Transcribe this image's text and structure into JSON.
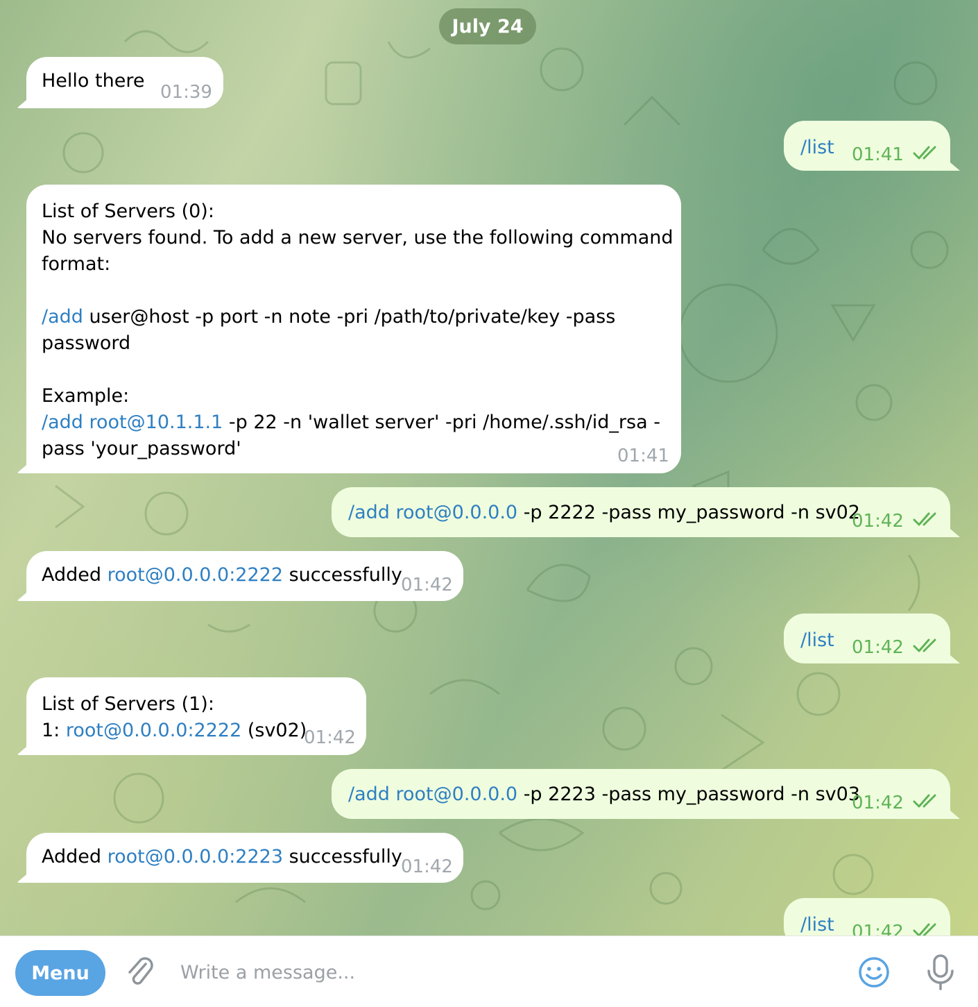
{
  "date_label": "July 24",
  "messages": [
    {
      "dir": "in",
      "time": "01:39",
      "lines": [
        [
          {
            "t": "Hello there"
          }
        ]
      ]
    },
    {
      "dir": "out",
      "time": "01:41",
      "lines": [
        [
          {
            "t": "/list",
            "link": true
          }
        ]
      ]
    },
    {
      "dir": "in",
      "time": "01:41",
      "lines": [
        [
          {
            "t": "List of Servers (0):"
          }
        ],
        [
          {
            "t": "No servers found. To add a new server, use the following command"
          }
        ],
        [
          {
            "t": "format:"
          }
        ],
        [
          {
            "t": ""
          }
        ],
        [
          {
            "t": "/add",
            "link": true
          },
          {
            "t": " user@host -p port -n note -pri /path/to/private/key -pass"
          }
        ],
        [
          {
            "t": "password"
          }
        ],
        [
          {
            "t": ""
          }
        ],
        [
          {
            "t": "Example:"
          }
        ],
        [
          {
            "t": "/add",
            "link": true
          },
          {
            "t": " "
          },
          {
            "t": "root@10.1.1.1",
            "link": true
          },
          {
            "t": " -p 22 -n 'wallet server' -pri /home/.ssh/id_rsa -"
          }
        ],
        [
          {
            "t": "pass 'your_password'"
          }
        ]
      ]
    },
    {
      "dir": "out",
      "time": "01:42",
      "lines": [
        [
          {
            "t": "/add",
            "link": true
          },
          {
            "t": " "
          },
          {
            "t": "root@0.0.0.0",
            "link": true
          },
          {
            "t": " -p 2222 -pass my_password -n sv02"
          }
        ]
      ]
    },
    {
      "dir": "in",
      "time": "01:42",
      "lines": [
        [
          {
            "t": "Added "
          },
          {
            "t": "root@0.0.0.0:2222",
            "link": true
          },
          {
            "t": " successfully"
          }
        ]
      ]
    },
    {
      "dir": "out",
      "time": "01:42",
      "lines": [
        [
          {
            "t": "/list",
            "link": true
          }
        ]
      ]
    },
    {
      "dir": "in",
      "time": "01:42",
      "lines": [
        [
          {
            "t": "List of Servers (1):"
          }
        ],
        [
          {
            "t": "1: "
          },
          {
            "t": "root@0.0.0.0:2222",
            "link": true
          },
          {
            "t": " (sv02)"
          }
        ]
      ]
    },
    {
      "dir": "out",
      "time": "01:42",
      "lines": [
        [
          {
            "t": "/add",
            "link": true
          },
          {
            "t": " "
          },
          {
            "t": "root@0.0.0.0",
            "link": true
          },
          {
            "t": " -p 2223 -pass my_password -n sv03"
          }
        ]
      ]
    },
    {
      "dir": "in",
      "time": "01:42",
      "lines": [
        [
          {
            "t": "Added "
          },
          {
            "t": "root@0.0.0.0:2223",
            "link": true
          },
          {
            "t": " successfully"
          }
        ]
      ]
    },
    {
      "dir": "out",
      "time": "01:42",
      "lines": [
        [
          {
            "t": "/list",
            "link": true
          }
        ]
      ]
    }
  ],
  "composer": {
    "menu_label": "Menu",
    "placeholder": "Write a message...",
    "icons": [
      "attach-icon",
      "emoji-icon",
      "microphone-icon"
    ]
  },
  "colors": {
    "link": "#2e7fc2",
    "incoming_bubble": "#ffffff",
    "outgoing_bubble": "#effdde",
    "outgoing_time": "#5fb356",
    "menu_button": "#59a4e3"
  }
}
